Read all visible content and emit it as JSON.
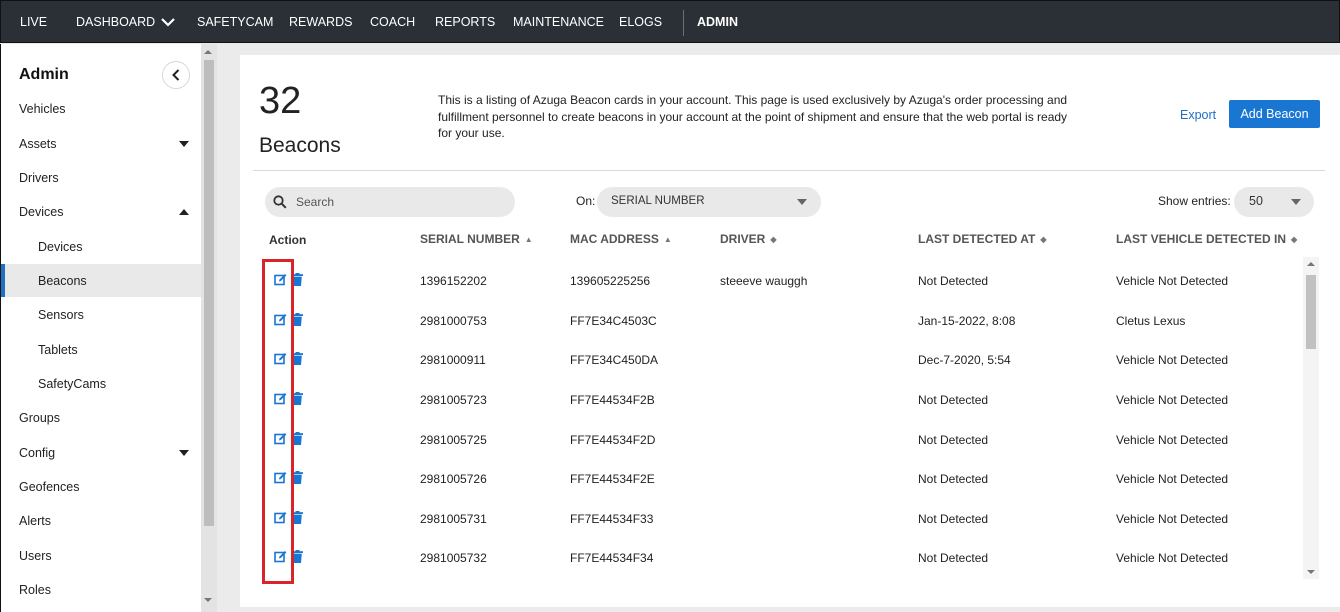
{
  "nav": {
    "items": [
      "LIVE",
      "DASHBOARD",
      "SAFETYCAM",
      "REWARDS",
      "COACH",
      "REPORTS",
      "MAINTENANCE",
      "ELOGS"
    ],
    "admin": "ADMIN"
  },
  "sidebar": {
    "title": "Admin",
    "items": [
      {
        "label": "Vehicles"
      },
      {
        "label": "Assets",
        "caret": "down"
      },
      {
        "label": "Drivers"
      },
      {
        "label": "Devices",
        "caret": "up"
      },
      {
        "label": "Devices",
        "sub": true
      },
      {
        "label": "Beacons",
        "sub": true,
        "active": true
      },
      {
        "label": "Sensors",
        "sub": true
      },
      {
        "label": "Tablets",
        "sub": true
      },
      {
        "label": "SafetyCams",
        "sub": true
      },
      {
        "label": "Groups"
      },
      {
        "label": "Config",
        "caret": "down"
      },
      {
        "label": "Geofences"
      },
      {
        "label": "Alerts"
      },
      {
        "label": "Users"
      },
      {
        "label": "Roles"
      }
    ]
  },
  "header": {
    "count": "32",
    "count_label": "Beacons",
    "description": "This is a listing of Azuga Beacon cards in your account. This page is used exclusively by Azuga's order processing and fulfillment personnel to create beacons in your account at the point of shipment and ensure that the web portal is ready for your use.",
    "export_label": "Export",
    "add_label": "Add Beacon"
  },
  "filters": {
    "search_placeholder": "Search",
    "on_label": "On:",
    "on_value": "SERIAL NUMBER",
    "show_label": "Show entries:",
    "show_value": "50"
  },
  "table": {
    "columns": {
      "action": "Action",
      "serial": "SERIAL NUMBER",
      "mac": "MAC ADDRESS",
      "driver": "DRIVER",
      "last_detected": "LAST DETECTED AT",
      "last_vehicle": "LAST VEHICLE DETECTED IN"
    },
    "rows": [
      {
        "serial": "1396152202",
        "mac": "139605225256",
        "driver": "steeeve wauggh",
        "last_detected": "Not Detected",
        "last_vehicle": "Vehicle Not Detected"
      },
      {
        "serial": "2981000753",
        "mac": "FF7E34C4503C",
        "driver": "",
        "last_detected": "Jan-15-2022, 8:08",
        "last_vehicle": "Cletus Lexus"
      },
      {
        "serial": "2981000911",
        "mac": "FF7E34C450DA",
        "driver": "",
        "last_detected": "Dec-7-2020, 5:54",
        "last_vehicle": "Vehicle Not Detected"
      },
      {
        "serial": "2981005723",
        "mac": "FF7E44534F2B",
        "driver": "",
        "last_detected": "Not Detected",
        "last_vehicle": "Vehicle Not Detected"
      },
      {
        "serial": "2981005725",
        "mac": "FF7E44534F2D",
        "driver": "",
        "last_detected": "Not Detected",
        "last_vehicle": "Vehicle Not Detected"
      },
      {
        "serial": "2981005726",
        "mac": "FF7E44534F2E",
        "driver": "",
        "last_detected": "Not Detected",
        "last_vehicle": "Vehicle Not Detected"
      },
      {
        "serial": "2981005731",
        "mac": "FF7E44534F33",
        "driver": "",
        "last_detected": "Not Detected",
        "last_vehicle": "Vehicle Not Detected"
      },
      {
        "serial": "2981005732",
        "mac": "FF7E44534F34",
        "driver": "",
        "last_detected": "Not Detected",
        "last_vehicle": "Vehicle Not Detected"
      }
    ]
  },
  "colors": {
    "accent": "#1976d2",
    "highlight": "#d9242c",
    "nav_bg": "#2b2f36"
  }
}
